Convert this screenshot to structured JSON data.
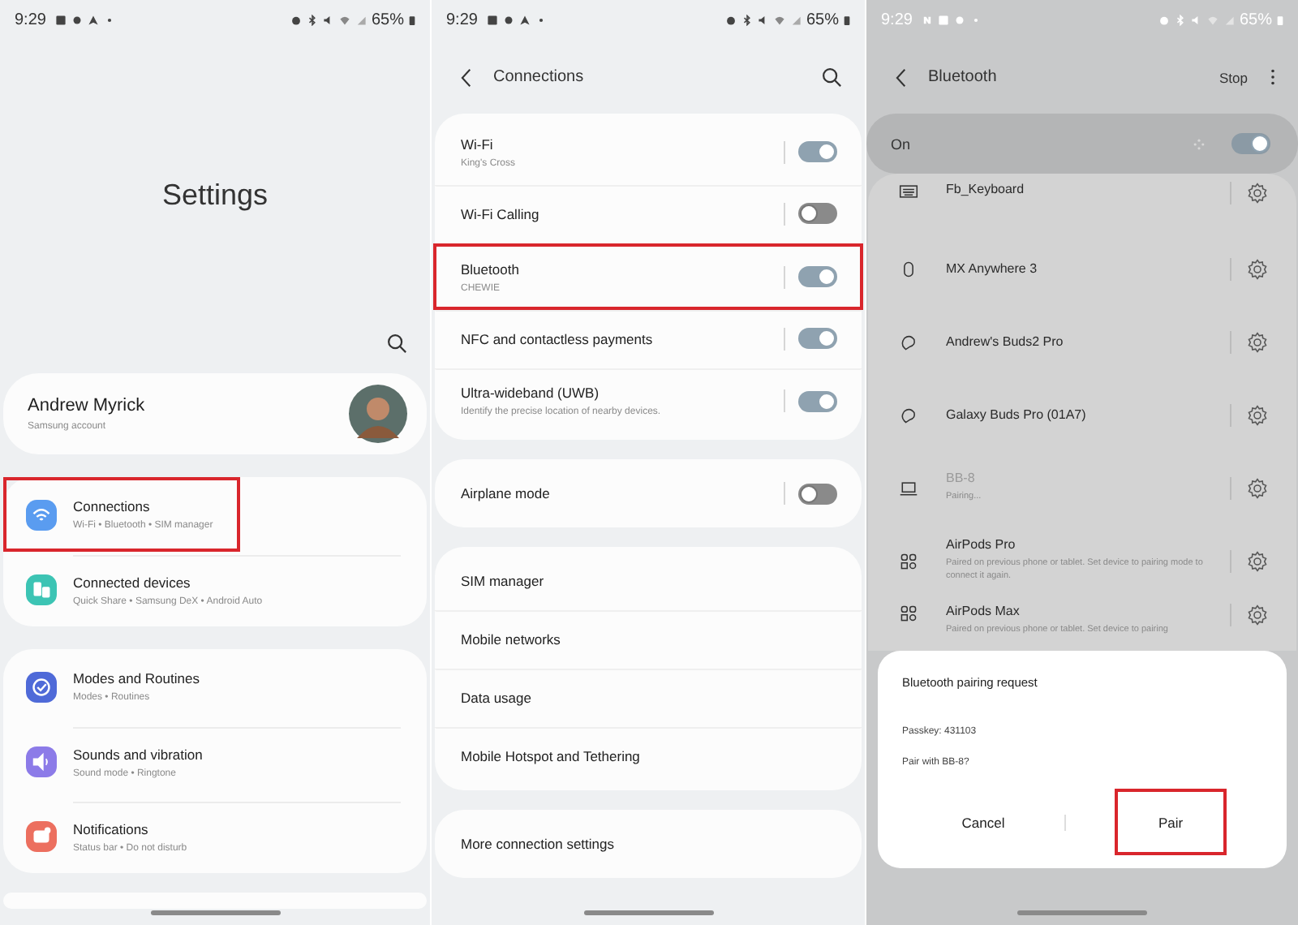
{
  "settings_screen": {
    "status_bar": {
      "time": "9:29",
      "battery": "65%"
    },
    "title": "Settings",
    "account": {
      "name": "Andrew Myrick",
      "subtitle": "Samsung account"
    },
    "groups": [
      {
        "items": [
          {
            "kind": "wifi",
            "color": "#5a9cf0",
            "title": "Connections",
            "subtitle": "Wi-Fi  •  Bluetooth  •  SIM manager",
            "highlighted": true
          },
          {
            "kind": "devices",
            "color": "#3cc4b4",
            "title": "Connected devices",
            "subtitle": "Quick Share  •  Samsung DeX  •  Android Auto",
            "highlighted": false
          }
        ]
      },
      {
        "items": [
          {
            "kind": "modes",
            "color": "#4f6ad8",
            "title": "Modes and Routines",
            "subtitle": "Modes  •  Routines",
            "highlighted": false
          },
          {
            "kind": "sound",
            "color": "#8c7be8",
            "title": "Sounds and vibration",
            "subtitle": "Sound mode  •  Ringtone",
            "highlighted": false
          },
          {
            "kind": "notifications",
            "color": "#ec6f5f",
            "title": "Notifications",
            "subtitle": "Status bar  •  Do not disturb",
            "highlighted": false
          }
        ]
      }
    ]
  },
  "connections_screen": {
    "status_bar": {
      "time": "9:29",
      "battery": "65%"
    },
    "title": "Connections",
    "groups": [
      {
        "items": [
          {
            "kind": "toggle",
            "title": "Wi-Fi",
            "subtitle": "King's Cross",
            "on": true,
            "highlighted": false
          },
          {
            "kind": "toggle",
            "title": "Wi-Fi Calling",
            "on": false,
            "highlighted": false
          },
          {
            "kind": "toggle",
            "title": "Bluetooth",
            "subtitle": "CHEWIE",
            "on": true,
            "highlighted": true
          },
          {
            "kind": "toggle",
            "title": "NFC and contactless payments",
            "on": true,
            "highlighted": false
          },
          {
            "kind": "toggle",
            "title": "Ultra-wideband (UWB)",
            "subtitle": "Identify the precise location of nearby devices.",
            "on": true,
            "highlighted": false
          }
        ]
      },
      {
        "items": [
          {
            "kind": "toggle",
            "title": "Airplane mode",
            "on": false,
            "highlighted": false
          }
        ]
      },
      {
        "items": [
          {
            "kind": "link",
            "title": "SIM manager",
            "highlighted": false
          },
          {
            "kind": "link",
            "title": "Mobile networks",
            "highlighted": false
          },
          {
            "kind": "link",
            "title": "Data usage",
            "highlighted": false
          },
          {
            "kind": "link",
            "title": "Mobile Hotspot and Tethering",
            "highlighted": false
          }
        ]
      },
      {
        "items": [
          {
            "kind": "link",
            "title": "More connection settings",
            "highlighted": false
          }
        ]
      }
    ]
  },
  "bluetooth_screen": {
    "status_bar": {
      "time": "9:29",
      "battery": "65%"
    },
    "title": "Bluetooth",
    "action": "Stop",
    "master": {
      "label": "On",
      "on": true
    },
    "devices": [
      {
        "kind": "keyboard",
        "name": "Fb_Keyboard",
        "greyed": false
      },
      {
        "kind": "mouse",
        "name": "MX Anywhere 3",
        "greyed": false
      },
      {
        "kind": "earbuds",
        "name": "Andrew's Buds2 Pro",
        "greyed": false
      },
      {
        "kind": "earbuds",
        "name": "Galaxy Buds Pro (01A7)",
        "greyed": false
      },
      {
        "kind": "laptop",
        "name": "BB-8",
        "status": "Pairing...",
        "greyed": true
      },
      {
        "kind": "generic",
        "name": "AirPods Pro",
        "status": "Paired on previous phone or tablet. Set device to pairing mode to connect it again.",
        "greyed": false
      },
      {
        "kind": "generic",
        "name": "AirPods Max",
        "status": "Paired on previous phone or tablet. Set device to pairing",
        "greyed": false
      }
    ],
    "dialog": {
      "title": "Bluetooth pairing request",
      "lines": [
        "Passkey: 431103",
        "Pair with BB-8?"
      ],
      "buttons": [
        {
          "label": "Cancel",
          "highlighted": false
        },
        {
          "label": "Pair",
          "highlighted": true
        }
      ]
    }
  }
}
